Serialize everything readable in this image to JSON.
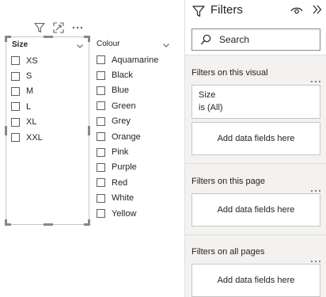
{
  "visual_header": {
    "icons": [
      "filter-icon",
      "focus-mode-icon",
      "more-options-icon"
    ]
  },
  "slicers": {
    "size": {
      "title": "Size",
      "options": [
        "XS",
        "S",
        "M",
        "L",
        "XL",
        "XXL"
      ]
    },
    "colour": {
      "title": "Colour",
      "options": [
        "Aquamarine",
        "Black",
        "Blue",
        "Green",
        "Grey",
        "Orange",
        "Pink",
        "Purple",
        "Red",
        "White",
        "Yellow"
      ]
    }
  },
  "filters_pane": {
    "title": "Filters",
    "search": {
      "placeholder": "Search"
    },
    "sections": {
      "visual": {
        "label": "Filters on this visual",
        "filter_card": {
          "field": "Size",
          "value": "is (All)"
        },
        "add_label": "Add data fields here"
      },
      "page": {
        "label": "Filters on this page",
        "add_label": "Add data fields here"
      },
      "all_pages": {
        "label": "Filters on all pages",
        "add_label": "Add data fields here"
      }
    }
  },
  "colors": {
    "text": "#252423",
    "pane_bg": "#f3f2f1",
    "border": "#c8c6c4",
    "handle": "#8a8886"
  }
}
